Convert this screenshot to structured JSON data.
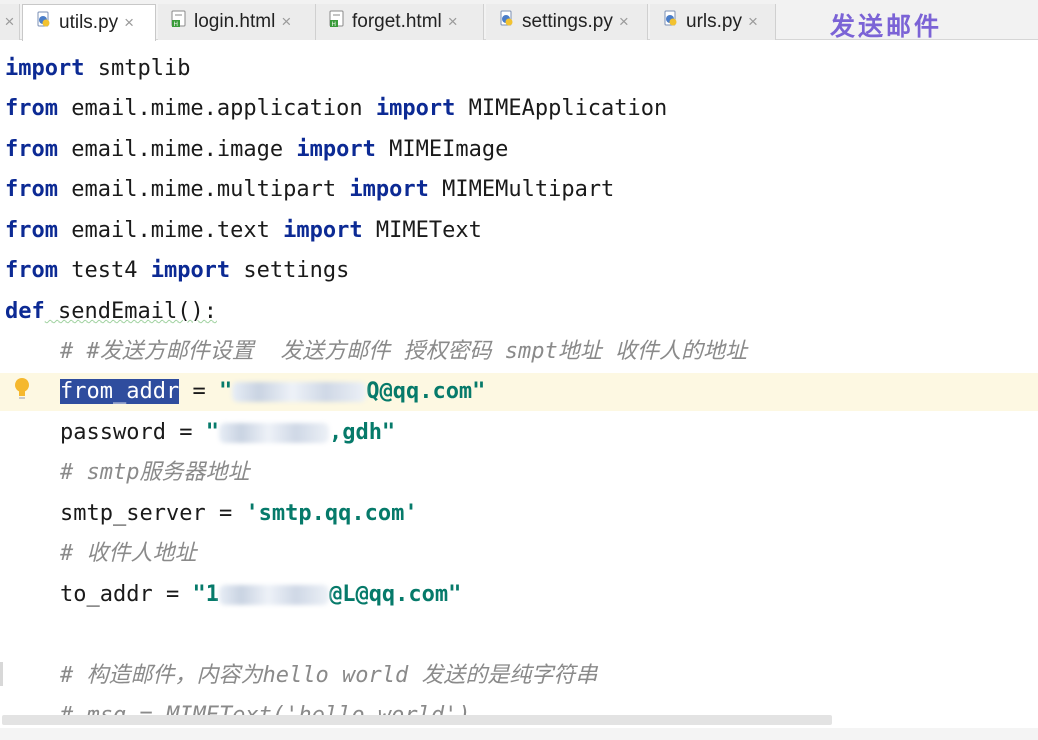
{
  "tabs": [
    {
      "label": "utils.py",
      "icon": "python-file-icon",
      "active": true
    },
    {
      "label": "login.html",
      "icon": "html-file-icon",
      "active": false
    },
    {
      "label": "forget.html",
      "icon": "html-file-icon",
      "active": false
    },
    {
      "label": "settings.py",
      "icon": "python-file-icon",
      "active": false
    },
    {
      "label": "urls.py",
      "icon": "python-file-icon",
      "active": false
    }
  ],
  "close_glyph": "×",
  "title_banner": "发送邮件",
  "code": {
    "l1": {
      "k1": "import",
      "t1": " smtplib"
    },
    "l2": {
      "k1": "from",
      "t1": " email.mime.application ",
      "k2": "import",
      "t2": " MIMEApplication"
    },
    "l3": {
      "k1": "from",
      "t1": " email.mime.image ",
      "k2": "import",
      "t2": " MIMEImage"
    },
    "l4": {
      "k1": "from",
      "t1": " email.mime.multipart ",
      "k2": "import",
      "t2": " MIMEMultipart"
    },
    "l5": {
      "k1": "from",
      "t1": " email.mime.text ",
      "k2": "import",
      "t2": " MIMEText"
    },
    "l6": {
      "k1": "from",
      "t1": " test4 ",
      "k2": "import",
      "t2": " settings"
    },
    "l7": {
      "k1": "def",
      "t1": " sendEmail():"
    },
    "l8": {
      "c": "# #发送方邮件设置  发送方邮件 授权密码 smpt地址 收件人的地址"
    },
    "l9": {
      "sel": "from_addr",
      "t1": " = ",
      "s1": "\"",
      "s2": "Q@qq.com\""
    },
    "l10": {
      "t1": "password = ",
      "s1": "\"",
      "s2": ",gdh\""
    },
    "l11": {
      "c": "# smtp服务器地址"
    },
    "l12": {
      "t1": "smtp_server = ",
      "s1": "'smtp.qq.com'"
    },
    "l13": {
      "c": "# 收件人地址"
    },
    "l14": {
      "t1": "to_addr = ",
      "s1": "\"1",
      "s2": "@L@qq.com\""
    },
    "l16": {
      "c": "# 构造邮件，内容为hello world 发送的是纯字符串"
    },
    "l17": {
      "c": "# msg = MIMEText('hello world')"
    }
  },
  "colors": {
    "keyword": "#0c2a94",
    "string": "#067a6a",
    "comment": "#8a8a8a",
    "selection": "#2f4d9e",
    "current_line": "#fdf8e2",
    "title": "#7b63d6"
  }
}
